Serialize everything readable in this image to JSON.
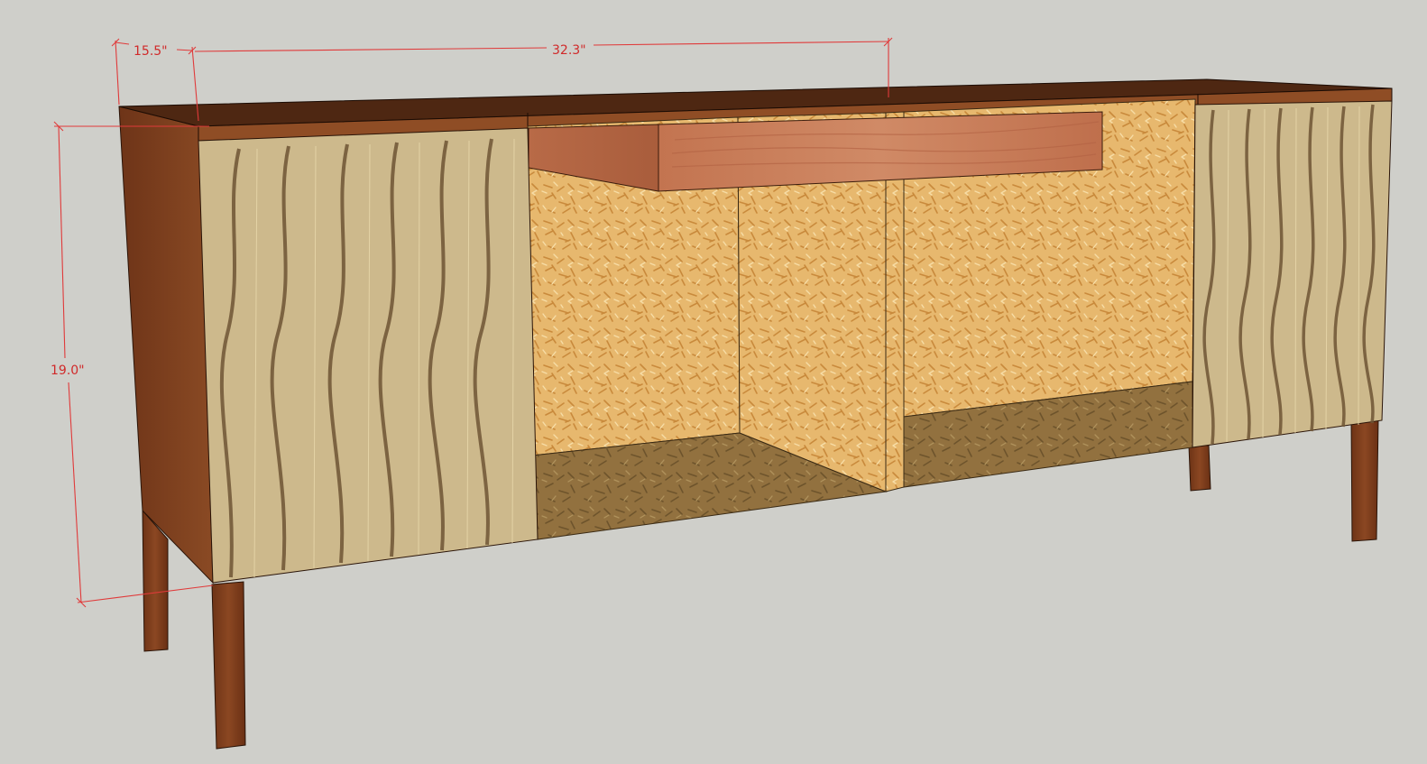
{
  "viewport": {
    "background": "#cfcfca"
  },
  "model": {
    "colors": {
      "walnut": "#7a3f1e",
      "walnut_dark": "#4e2612",
      "top_surface": "#4a2410",
      "top_edge": "#8a4a22",
      "door_veneer": "#cdb88a",
      "door_inlay": "#6e5536",
      "osb": "#e6b56a",
      "osb_shadow": "#9a7a4c",
      "drawer_front": "#c47a58",
      "leg": "#7c3d1c"
    }
  },
  "dimensions": {
    "depth_label": "15.5\"",
    "width_label": "32.3\"",
    "height_label": "19.0\"",
    "color": "#e03a3a"
  }
}
